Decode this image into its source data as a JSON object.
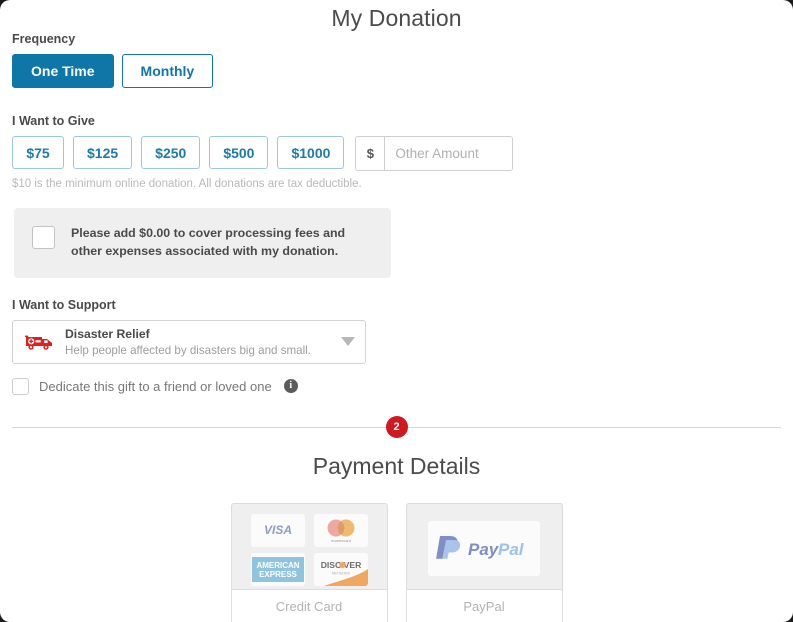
{
  "donation": {
    "title": "My Donation",
    "frequency": {
      "label": "Frequency",
      "options": [
        {
          "label": "One Time",
          "selected": true
        },
        {
          "label": "Monthly",
          "selected": false
        }
      ]
    },
    "give": {
      "label": "I Want to Give",
      "amounts": [
        "$75",
        "$125",
        "$250",
        "$500",
        "$1000"
      ],
      "other_prefix": "$",
      "other_placeholder": "Other Amount",
      "other_value": "",
      "disclaimer": "$10 is the minimum online donation. All donations are tax deductible."
    },
    "fee": {
      "checked": false,
      "text": "Please add $0.00 to cover processing fees and other expenses associated with my donation."
    },
    "support": {
      "label": "I Want to Support",
      "icon": "ambulance-icon",
      "selected_title": "Disaster Relief",
      "selected_description": "Help people affected by disasters big and small.",
      "caret": "chevron-down-icon"
    },
    "dedicate": {
      "checked": false,
      "text": "Dedicate this gift to a friend or loved one",
      "info_glyph": "i"
    }
  },
  "step_badge": "2",
  "payment": {
    "title": "Payment Details",
    "methods": [
      {
        "name": "Credit Card",
        "logos": [
          "VISA",
          "mastercard",
          "AMERICAN EXPRESS",
          "DISCOVER"
        ]
      },
      {
        "name": "PayPal",
        "logos": [
          "PayPal"
        ]
      }
    ]
  },
  "colors": {
    "accent_blue": "#0f76a8",
    "amount_blue": "#1c7ba8",
    "badge_red": "#d0191f",
    "panel_gray": "#efefef",
    "muted_text": "#b3b3b3"
  }
}
